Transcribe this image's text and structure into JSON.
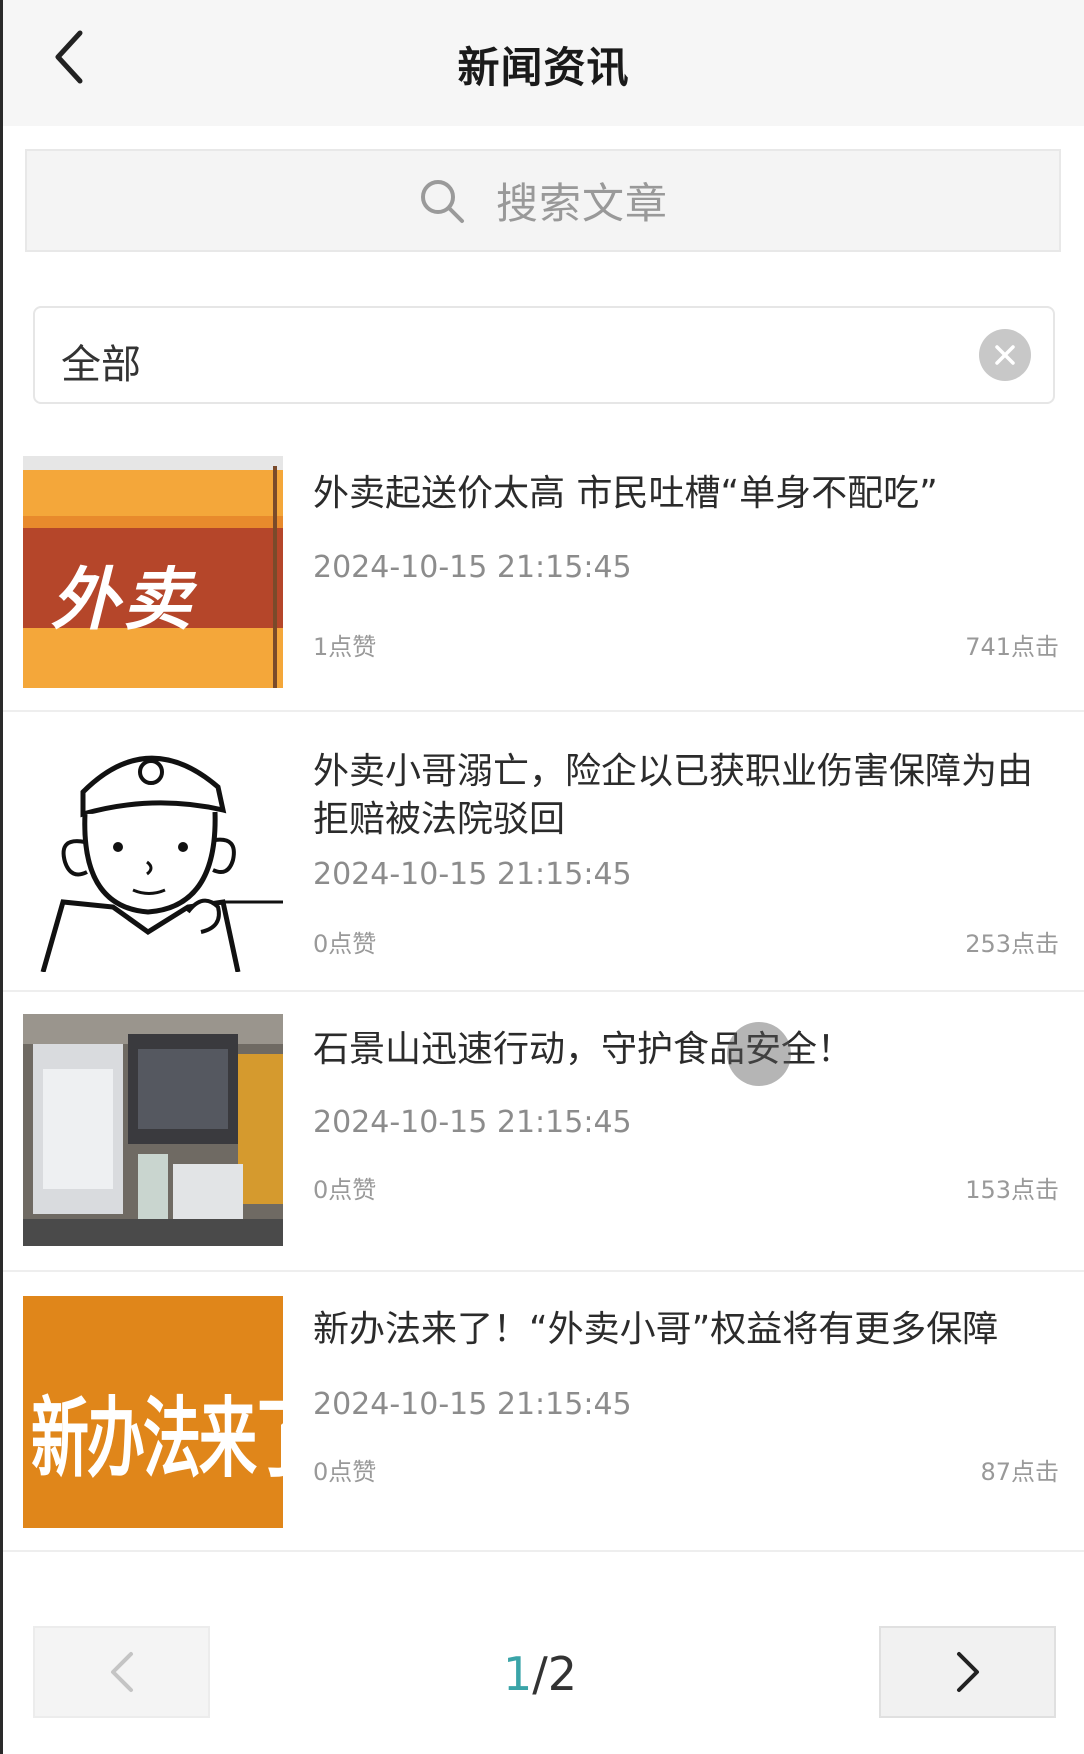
{
  "header": {
    "title": "新闻资讯"
  },
  "search": {
    "placeholder": "搜索文章"
  },
  "filter": {
    "value": "全部"
  },
  "news": [
    {
      "title": "外卖起送价太高 市民吐槽“单身不配吃”",
      "date": "2024-10-15 21:15:45",
      "likes": "1点赞",
      "clicks": "741点击",
      "thumb_text": "外卖"
    },
    {
      "title": "外卖小哥溺亡，险企以已获职业伤害保障为由拒赔被法院驳回",
      "date": "2024-10-15 21:15:45",
      "likes": "0点赞",
      "clicks": "253点击"
    },
    {
      "title": "石景山迅速行动，守护食品安全！",
      "date": "2024-10-15 21:15:45",
      "likes": "0点赞",
      "clicks": "153点击"
    },
    {
      "title": "新办法来了！“外卖小哥”权益将有更多保障",
      "date": "2024-10-15 21:15:45",
      "likes": "0点赞",
      "clicks": "87点击",
      "thumb_text": "新办法来了!"
    }
  ],
  "pagination": {
    "current": "1",
    "separator": "/",
    "total": "2"
  },
  "colors": {
    "accent": "#3aa4a8",
    "thumb_orange": "#e0861a",
    "thumb_red": "#b5462a"
  }
}
